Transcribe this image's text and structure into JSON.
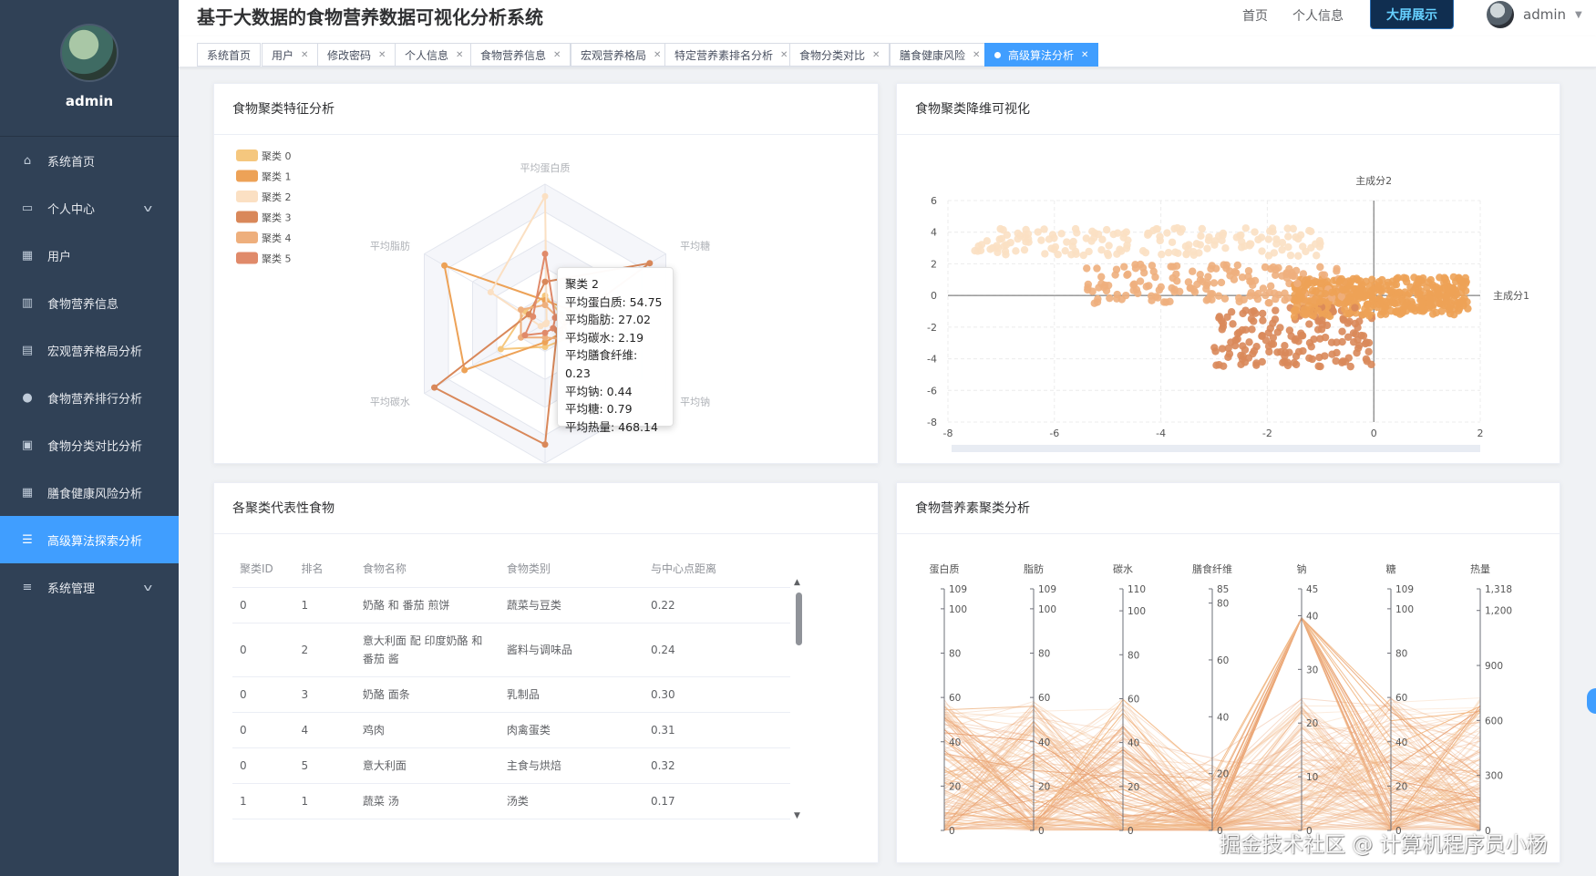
{
  "app": {
    "title": "基于大数据的食物营养数据可视化分析系统",
    "nav_home": "首页",
    "nav_profile": "个人信息",
    "big_screen": "大屏展示",
    "user": "admin"
  },
  "sidebar": {
    "profile_name": "admin",
    "items": [
      {
        "label": "系统首页",
        "icon": "home-icon",
        "active": false
      },
      {
        "label": "个人中心",
        "icon": "id-card-icon",
        "active": false,
        "expandable": true
      },
      {
        "label": "用户",
        "icon": "grid-icon",
        "active": false
      },
      {
        "label": "食物营养信息",
        "icon": "bar-chart-icon",
        "active": false
      },
      {
        "label": "宏观营养格局分析",
        "icon": "printer-icon",
        "active": false
      },
      {
        "label": "食物营养排行分析",
        "icon": "bulb-icon",
        "active": false
      },
      {
        "label": "食物分类对比分析",
        "icon": "clipboard-icon",
        "active": false
      },
      {
        "label": "膳食健康风险分析",
        "icon": "grid-icon",
        "active": false
      },
      {
        "label": "高级算法探索分析",
        "icon": "list-icon",
        "active": true
      },
      {
        "label": "系统管理",
        "icon": "sliders-icon",
        "active": false,
        "expandable": true
      }
    ]
  },
  "tabs": [
    {
      "label": "系统首页",
      "closable": false
    },
    {
      "label": "用户",
      "closable": true
    },
    {
      "label": "修改密码",
      "closable": true
    },
    {
      "label": "个人信息",
      "closable": true
    },
    {
      "label": "食物营养信息",
      "closable": true
    },
    {
      "label": "宏观营养格局",
      "closable": true
    },
    {
      "label": "特定营养素排名分析",
      "closable": true
    },
    {
      "label": "食物分类对比",
      "closable": true
    },
    {
      "label": "膳食健康风险",
      "closable": true
    },
    {
      "label": "高级算法分析",
      "closable": true,
      "active": true
    }
  ],
  "panels": {
    "radar_title": "食物聚类特征分析",
    "scatter_title": "食物聚类降维可视化",
    "table_title": "各聚类代表性食物",
    "parallel_title": "食物营养素聚类分析"
  },
  "colors": {
    "sidebar_bg": "#304156",
    "accent": "#409eff",
    "clusters": [
      "#f5c77e",
      "#eda257",
      "#fbe0c3",
      "#d9885a",
      "#eeaf7d",
      "#e08a6a"
    ]
  },
  "tooltip": {
    "title": "聚类 2",
    "lines": [
      "平均蛋白质: 54.75",
      "平均脂肪: 27.02",
      "平均碳水: 2.19",
      "平均膳食纤维: 0.23",
      "平均钠: 0.44",
      "平均糖: 0.79",
      "平均热量: 468.14"
    ]
  },
  "table": {
    "headers": [
      "聚类ID",
      "排名",
      "食物名称",
      "食物类别",
      "与中心点距离"
    ],
    "rows": [
      [
        "0",
        "1",
        "奶酪 和 番茄 煎饼",
        "蔬菜与豆类",
        "0.22"
      ],
      [
        "0",
        "2",
        "意大利面 配 印度奶酪 和 番茄 酱",
        "酱料与调味品",
        "0.24"
      ],
      [
        "0",
        "3",
        "奶酪 面条",
        "乳制品",
        "0.30"
      ],
      [
        "0",
        "4",
        "鸡肉",
        "肉禽蛋类",
        "0.31"
      ],
      [
        "0",
        "5",
        "意大利面",
        "主食与烘焙",
        "0.32"
      ],
      [
        "1",
        "1",
        "蔬菜 汤",
        "汤类",
        "0.17"
      ]
    ]
  },
  "watermark": "掘金技术社区 @ 计算机程序员小杨",
  "chart_data": [
    {
      "type": "radar",
      "indicators": [
        "平均蛋白质",
        "平均糖",
        "平均钠",
        "平均膳食纤维",
        "平均碳水",
        "平均脂肪"
      ],
      "max": [
        60,
        60,
        60,
        60,
        60,
        60
      ],
      "legend": [
        "聚类 0",
        "聚类 1",
        "聚类 2",
        "聚类 3",
        "聚类 4",
        "聚类 5"
      ],
      "series": [
        {
          "name": "聚类 0",
          "values": [
            12,
            8,
            12,
            10,
            22,
            10
          ]
        },
        {
          "name": "聚类 1",
          "values": [
            10,
            12,
            8,
            8,
            40,
            50
          ]
        },
        {
          "name": "聚类 2",
          "values": [
            54.75,
            0.79,
            0.44,
            0.23,
            2.19,
            27.02
          ]
        },
        {
          "name": "聚类 3",
          "values": [
            18,
            52,
            6,
            52,
            55,
            8
          ]
        },
        {
          "name": "聚类 4",
          "values": [
            8,
            6,
            14,
            6,
            12,
            12
          ]
        },
        {
          "name": "聚类 5",
          "values": [
            30,
            5,
            4,
            4,
            10,
            6
          ]
        }
      ]
    },
    {
      "type": "scatter",
      "xlabel": "主成分1",
      "ylabel": "主成分2",
      "xlim": [
        -8,
        2
      ],
      "ylim": [
        -8,
        6
      ],
      "xticks": [
        -8,
        -6,
        -4,
        -2,
        0,
        2
      ],
      "yticks": [
        -8,
        -6,
        -4,
        -2,
        0,
        2,
        4,
        6
      ]
    },
    {
      "type": "parallel",
      "axes": [
        {
          "name": "蛋白质",
          "max": 109,
          "ticks": [
            0,
            20,
            40,
            60,
            80,
            100,
            109
          ]
        },
        {
          "name": "脂肪",
          "max": 109,
          "ticks": [
            0,
            20,
            40,
            60,
            80,
            100,
            109
          ]
        },
        {
          "name": "碳水",
          "max": 110,
          "ticks": [
            0,
            20,
            40,
            60,
            80,
            100,
            110
          ]
        },
        {
          "name": "膳食纤维",
          "max": 85,
          "ticks": [
            0,
            20,
            40,
            60,
            80,
            85
          ]
        },
        {
          "name": "钠",
          "max": 45,
          "ticks": [
            0,
            10,
            20,
            30,
            40,
            45
          ]
        },
        {
          "name": "糖",
          "max": 109,
          "ticks": [
            0,
            20,
            40,
            60,
            80,
            100,
            109
          ]
        },
        {
          "name": "热量",
          "max": 1318,
          "ticks": [
            0,
            300,
            600,
            900,
            1200,
            1318
          ]
        }
      ],
      "tick_labels": [
        [
          "0",
          "20",
          "40",
          "60",
          "80",
          "100",
          "109"
        ],
        [
          "0",
          "20",
          "40",
          "60",
          "80",
          "100",
          "109"
        ],
        [
          "0",
          "20",
          "40",
          "60",
          "80",
          "100",
          "110"
        ],
        [
          "0",
          "20",
          "40",
          "60",
          "80",
          "85"
        ],
        [
          "0",
          "10",
          "20",
          "30",
          "40",
          "45"
        ],
        [
          "0",
          "20",
          "40",
          "60",
          "80",
          "100",
          "109"
        ],
        [
          "0",
          "300",
          "600",
          "900",
          "1,200",
          "1,318"
        ]
      ]
    }
  ]
}
